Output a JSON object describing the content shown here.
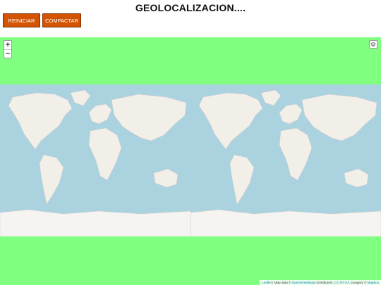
{
  "header": {
    "title": "GEOLOCALIZACION...."
  },
  "buttons": {
    "reset_label": "REINICIAR",
    "compact_label": "COMPACTAR"
  },
  "map": {
    "zoom_in": "+",
    "zoom_out": "−",
    "attribution": {
      "leaflet": "Leaflet",
      "map_data": "| Map data ©",
      "osm": "OpenStreetMap",
      "contributors": "contributors,",
      "license": "CC-BY-SA",
      "imagery": ", Imagery ©",
      "provider": "Mapbox"
    }
  },
  "colors": {
    "button_bg": "#d35400",
    "map_background": "#80ff80",
    "ocean": "#aad3df",
    "land": "#f2efe9",
    "antarctica": "#f5f4f0"
  },
  "icons": {
    "layers": "layers-icon"
  }
}
